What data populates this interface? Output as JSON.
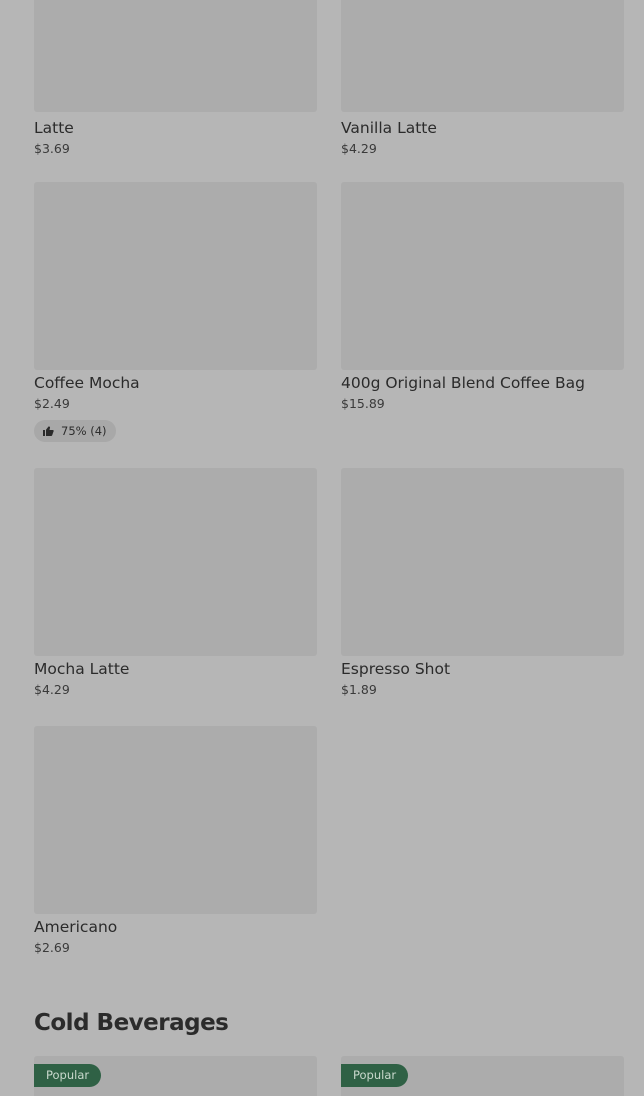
{
  "products": [
    {
      "name": "Latte",
      "price": "$3.69"
    },
    {
      "name": "Vanilla Latte",
      "price": "$4.29"
    },
    {
      "name": "Coffee Mocha",
      "price": "$2.49",
      "rating": "75% (4)"
    },
    {
      "name": "400g Original Blend Coffee Bag",
      "price": "$15.89"
    },
    {
      "name": "Mocha Latte",
      "price": "$4.29"
    },
    {
      "name": "Espresso Shot",
      "price": "$1.89"
    },
    {
      "name": "Americano",
      "price": "$2.69"
    }
  ],
  "cold_section": {
    "title": "Cold Beverages",
    "items": [
      {
        "badge": "Popular"
      },
      {
        "badge": "Popular"
      }
    ]
  },
  "icons": {
    "rating": "thumbs-up-icon"
  },
  "colors": {
    "background": "#b6b6b6",
    "image_placeholder": "#acacac",
    "badge": "#2f6145"
  }
}
